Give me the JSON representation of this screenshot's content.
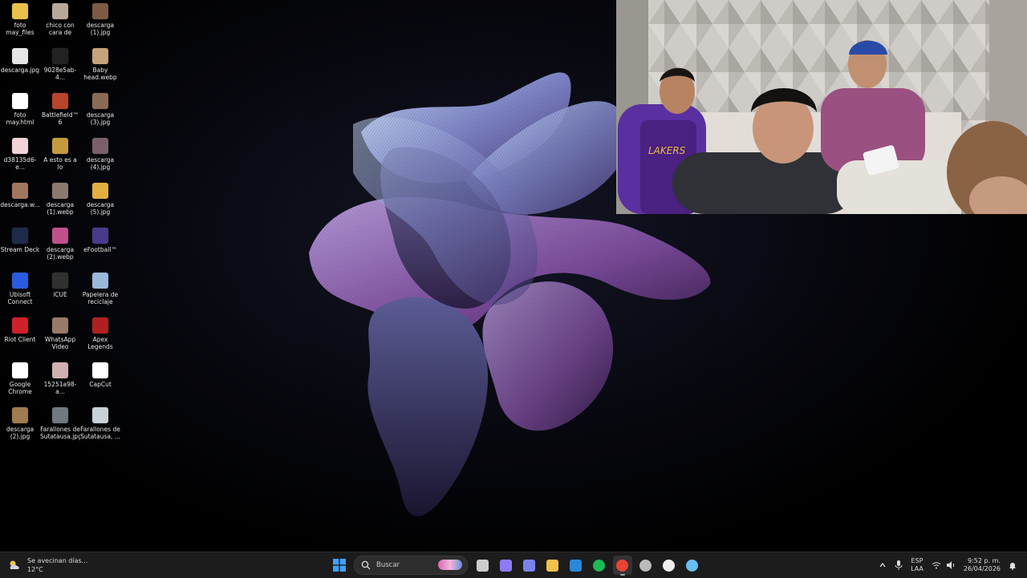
{
  "desktop_icons": [
    {
      "label": "foto\nmay_files",
      "icon": "folder-icon",
      "color": "#e8c04a"
    },
    {
      "label": "chico con\ncara de asc...",
      "icon": "image-icon",
      "color": "#b9a89a"
    },
    {
      "label": "descarga\n(1).jpg",
      "icon": "image-icon",
      "color": "#7d5a44"
    },
    {
      "label": "descarga.jpg",
      "icon": "image-icon",
      "color": "#e6e6e6"
    },
    {
      "label": "9028e5ab-4...",
      "icon": "image-icon",
      "color": "#222222"
    },
    {
      "label": "Baby\nhead.webp",
      "icon": "image-icon",
      "color": "#c7a27a"
    },
    {
      "label": "foto\nmay.html",
      "icon": "chrome-doc-icon",
      "color": "#ffffff"
    },
    {
      "label": "Battlefield™ 6",
      "icon": "game-icon",
      "color": "#b8442c"
    },
    {
      "label": "descarga\n(3).jpg",
      "icon": "image-icon",
      "color": "#8a6a55"
    },
    {
      "label": "d38135d6-e...",
      "icon": "image-icon",
      "color": "#f0d2d8"
    },
    {
      "label": "A esto es a lo\nque los col...",
      "icon": "image-icon",
      "color": "#c49a3c"
    },
    {
      "label": "descarga\n(4).jpg",
      "icon": "image-icon",
      "color": "#7a5e6a"
    },
    {
      "label": "descarga.w...",
      "icon": "image-icon",
      "color": "#a07860"
    },
    {
      "label": "descarga\n(1).webp",
      "icon": "image-icon",
      "color": "#8c7a70"
    },
    {
      "label": "descarga\n(5).jpg",
      "icon": "image-icon",
      "color": "#e0b040"
    },
    {
      "label": "Stream Deck",
      "icon": "stream-deck-icon",
      "color": "#1e2a4a"
    },
    {
      "label": "descarga\n(2).webp",
      "icon": "image-icon",
      "color": "#c0508a"
    },
    {
      "label": "eFootball™",
      "icon": "game-icon",
      "color": "#4a3a8a"
    },
    {
      "label": "Ubisoft\nConnect",
      "icon": "ubisoft-icon",
      "color": "#2a5adf"
    },
    {
      "label": "iCUE",
      "icon": "icue-icon",
      "color": "#303030"
    },
    {
      "label": "Papelera de\nreciclaje",
      "icon": "recycle-bin-icon",
      "color": "#9ab8d8"
    },
    {
      "label": "Riot Client",
      "icon": "riot-icon",
      "color": "#d0202a"
    },
    {
      "label": "WhatsApp\nVideo 2026-...",
      "icon": "video-icon",
      "color": "#9a7a6a"
    },
    {
      "label": "Apex\nLegends",
      "icon": "apex-icon",
      "color": "#b02020"
    },
    {
      "label": "Google\nChrome",
      "icon": "chrome-icon",
      "color": "#ffffff"
    },
    {
      "label": "15251a98-a...",
      "icon": "image-icon",
      "color": "#d0b0b0"
    },
    {
      "label": "CapCut",
      "icon": "capcut-icon",
      "color": "#ffffff"
    },
    {
      "label": "descarga\n(2).jpg",
      "icon": "image-icon",
      "color": "#a07a50"
    },
    {
      "label": "Farallones de\nSutatausa.jpg",
      "icon": "image-icon",
      "color": "#707880"
    },
    {
      "label": "Farallones de\nSutatausa, ...",
      "icon": "image-icon",
      "color": "#c8d0d8"
    }
  ],
  "taskbar": {
    "weather_line1": "Se avecinan días...",
    "weather_line2": "12°C",
    "search_placeholder": "Buscar",
    "apps": [
      {
        "name": "start-button",
        "icon": "windows-icon",
        "color": "#3fa0ff",
        "active": false
      },
      {
        "name": "task-view-button",
        "icon": "task-view-icon",
        "color": "#cccccc",
        "active": false
      },
      {
        "name": "copilot-button",
        "icon": "copilot-icon",
        "color": "#8f7af5",
        "active": false
      },
      {
        "name": "teams-button",
        "icon": "teams-icon",
        "color": "#7b83eb",
        "active": false
      },
      {
        "name": "file-explorer-button",
        "icon": "folder-icon",
        "color": "#f2c14e",
        "active": false
      },
      {
        "name": "store-button",
        "icon": "store-icon",
        "color": "#2b88d8",
        "active": false
      },
      {
        "name": "spotify-button",
        "icon": "spotify-icon",
        "color": "#1db954",
        "active": false
      },
      {
        "name": "chrome-button",
        "icon": "chrome-icon",
        "color": "#ea4335",
        "active": true
      },
      {
        "name": "settings-app-button",
        "icon": "gear-icon",
        "color": "#bbbbbb",
        "active": false
      },
      {
        "name": "github-button",
        "icon": "github-icon",
        "color": "#eeeeee",
        "active": false
      },
      {
        "name": "steam-button",
        "icon": "steam-icon",
        "color": "#66c0f4",
        "active": false
      }
    ],
    "lang_top": "ESP",
    "lang_bottom": "LAA",
    "time": "9:52 p. m.",
    "date": "26/04/2026"
  },
  "colors": {
    "taskbar_bg": "#1c1c1c",
    "accent": "#3fa0ff"
  }
}
